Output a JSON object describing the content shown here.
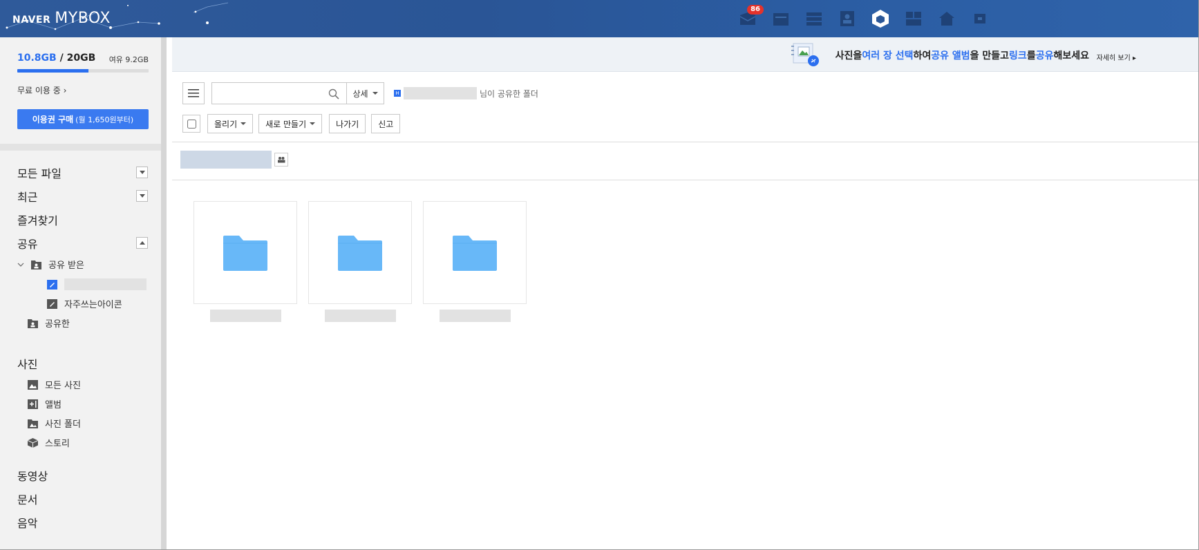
{
  "header": {
    "brand_small": "NAVER",
    "brand_large": "MYBOX",
    "apps": [
      {
        "name": "mail-icon",
        "badge": "86"
      },
      {
        "name": "calendar-icon"
      },
      {
        "name": "list-icon"
      },
      {
        "name": "contacts-icon"
      },
      {
        "name": "mybox-icon"
      },
      {
        "name": "keep-icon"
      },
      {
        "name": "house-icon"
      },
      {
        "name": "more-icon"
      }
    ]
  },
  "storage": {
    "used": "10.8GB",
    "separator": " / ",
    "total": "20GB",
    "free": "여유 9.2GB",
    "used_fraction": 0.54,
    "plan": "무료 이용 중",
    "buy_label": "이용권 구매",
    "buy_sub": "(월 1,650원부터)"
  },
  "nav": {
    "all_files": "모든 파일",
    "recent": "최근",
    "favorites": "즐겨찾기",
    "shared": "공유",
    "shared_received": "공유 받은",
    "frequent_icons": "자주쓰는아이콘",
    "shared_by_me": "공유한",
    "photos": "사진",
    "all_photos": "모든 사진",
    "album": "앨범",
    "photo_folders": "사진 폴더",
    "story": "스토리",
    "video": "동영상",
    "documents": "문서",
    "music": "음악"
  },
  "banner": {
    "p1": "사진을 ",
    "h1": "여러 장 선택",
    "p2": "하여 ",
    "h2": "공유 앨범",
    "p3": "을 만들고 ",
    "h3": "링크",
    "p4": "를 ",
    "h4": "공유",
    "p5": "해보세요",
    "more": "자세히 보기 ▸"
  },
  "toolbar": {
    "search_value": "",
    "detail_label": "상세",
    "owner_suffix": "님이 공유한 폴더",
    "upload_label": "올리기",
    "new_label": "새로 만들기",
    "leave_label": "나가기",
    "report_label": "신고"
  },
  "colors": {
    "accent": "#2b6fef",
    "folder": "#68b8f8",
    "header": "#2c5898"
  }
}
